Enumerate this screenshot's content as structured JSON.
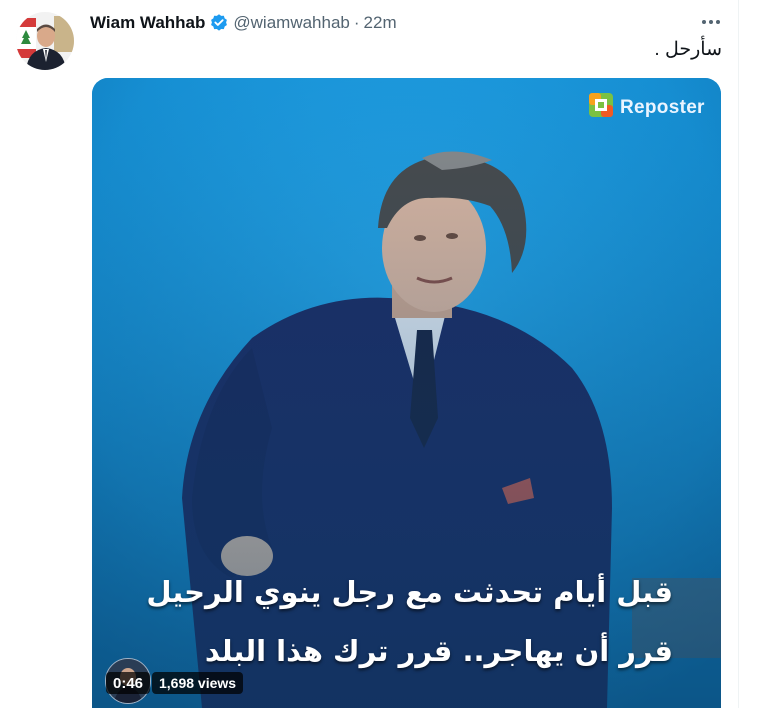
{
  "tweet": {
    "author_name": "Wiam Wahhab",
    "handle": "@wiamwahhab",
    "separator": "·",
    "timestamp": "22m",
    "verified": true,
    "text": "سأرحل ."
  },
  "media": {
    "watermark": "Reposter",
    "caption_line1": "قبل أيام تحدثت مع رجل ينوي الرحيل",
    "caption_line2": "قرر أن يهاجر.. قرر ترك هذا البلد",
    "duration": "0:46",
    "views": "1,698 views",
    "background_color": "#1f9de0"
  },
  "icons": {
    "verified": "verified-badge-icon",
    "more": "more-options-icon",
    "watermark": "reposter-logo-icon"
  },
  "colors": {
    "accent": "#1d9bf0",
    "text_primary": "#0f1419",
    "text_secondary": "#536471"
  }
}
